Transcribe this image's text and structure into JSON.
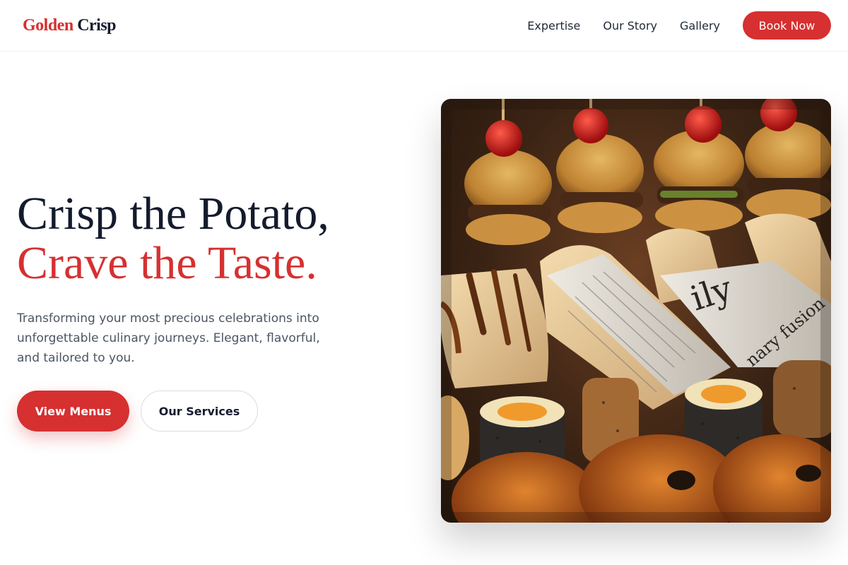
{
  "header": {
    "logo_part1": "Golden",
    "logo_part2": "Crisp",
    "nav": [
      "Expertise",
      "Our Story",
      "Gallery"
    ],
    "cta": "Book Now"
  },
  "hero": {
    "headline_line1": "Crisp the Potato,",
    "headline_line2": "Crave the Taste.",
    "description": "Transforming your most precious celebrations into unforgettable culinary journeys. Elegant, flavorful, and tailored to you.",
    "primary_button": "View Menus",
    "secondary_button": "Our Services",
    "image": {
      "subject": "catering platter with sliders, wraps in newspaper and sushi rolls",
      "newspaper_text": "ily",
      "newspaper_text2": "nary fusion"
    }
  },
  "colors": {
    "accent": "#d63031",
    "heading": "#141b2d",
    "body_text": "#4b5563"
  }
}
